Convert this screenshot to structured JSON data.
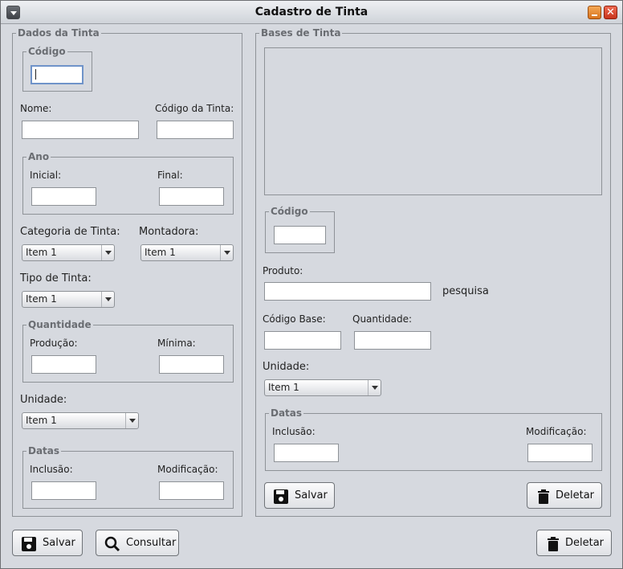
{
  "window": {
    "title": "Cadastro de Tinta"
  },
  "left": {
    "legend": "Dados da Tinta",
    "codigo_legend": "Código",
    "nome_label": "Nome:",
    "codigo_tinta_label": "Código da Tinta:",
    "ano_legend": "Ano",
    "inicial_label": "Inicial:",
    "final_label": "Final:",
    "categoria_label": "Categoria de Tinta:",
    "categoria_value": "Item 1",
    "montadora_label": "Montadora:",
    "montadora_value": "Item 1",
    "tipo_label": "Tipo de Tinta:",
    "tipo_value": "Item 1",
    "quantidade_legend": "Quantidade",
    "producao_label": "Produção:",
    "minima_label": "Mínima:",
    "unidade_label": "Unidade:",
    "unidade_value": "Item 1",
    "datas_legend": "Datas",
    "inclusao_label": "Inclusão:",
    "modificacao_label": "Modificação:"
  },
  "right": {
    "legend": "Bases de Tinta",
    "codigo_legend": "Código",
    "produto_label": "Produto:",
    "pesquisa_label": "pesquisa",
    "codigo_base_label": "Código Base:",
    "quantidade_label": "Quantidade:",
    "unidade_label": "Unidade:",
    "unidade_value": "Item 1",
    "datas_legend": "Datas",
    "inclusao_label": "Inclusão:",
    "modificacao_label": "Modificação:",
    "salvar": "Salvar",
    "deletar": "Deletar"
  },
  "footer": {
    "salvar": "Salvar",
    "consultar": "Consultar",
    "deletar": "Deletar"
  },
  "icons": {
    "save": "floppy-disk-icon",
    "search": "magnifier-icon",
    "delete": "trash-can-icon"
  }
}
